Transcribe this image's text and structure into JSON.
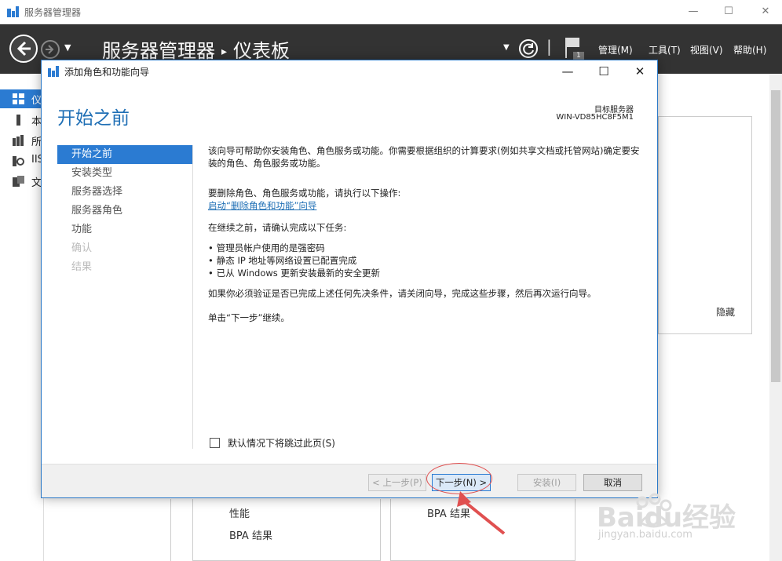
{
  "window": {
    "title": "服务器管理器",
    "buttons": {
      "minimize": "—",
      "maximize": "☐",
      "close": "✕"
    }
  },
  "header": {
    "breadcrumb_root": "服务器管理器",
    "breadcrumb_sep": "▸",
    "breadcrumb_current": "仪表板",
    "flag_badge": "1",
    "menus": [
      {
        "label": "管理(M)"
      },
      {
        "label": "工具(T)"
      },
      {
        "label": "视图(V)"
      },
      {
        "label": "帮助(H)"
      }
    ]
  },
  "sidebar": {
    "items": [
      {
        "label": "仪",
        "icon": "dashboard-icon"
      },
      {
        "label": "本",
        "icon": "local-server-icon"
      },
      {
        "label": "所",
        "icon": "all-servers-icon"
      },
      {
        "label": "IIS",
        "icon": "iis-icon"
      },
      {
        "label": "文",
        "icon": "file-services-icon"
      }
    ]
  },
  "background": {
    "hide_label": "隐藏",
    "tile_left": [
      "性能",
      "BPA 结果"
    ],
    "tile_right": [
      "BPA 结果"
    ]
  },
  "dialog": {
    "title": "添加角色和功能向导",
    "heading": "开始之前",
    "target_label": "目标服务器",
    "target_value": "WIN-VD85HC8F5M1",
    "steps": [
      {
        "label": "开始之前",
        "state": "active"
      },
      {
        "label": "安装类型",
        "state": "normal"
      },
      {
        "label": "服务器选择",
        "state": "normal"
      },
      {
        "label": "服务器角色",
        "state": "normal"
      },
      {
        "label": "功能",
        "state": "normal"
      },
      {
        "label": "确认",
        "state": "disabled"
      },
      {
        "label": "结果",
        "state": "disabled"
      }
    ],
    "content": {
      "intro": "该向导可帮助你安装角色、角色服务或功能。你需要根据组织的计算要求(例如共享文档或托管网站)确定要安装的角色、角色服务或功能。",
      "remove_text": "要删除角色、角色服务或功能，请执行以下操作:",
      "remove_link": "启动“删除角色和功能”向导",
      "before_text": "在继续之前，请确认完成以下任务:",
      "tasks": [
        "管理员帐户使用的是强密码",
        "静态 IP 地址等网络设置已配置完成",
        "已从 Windows 更新安装最新的安全更新"
      ],
      "verify_text": "如果你必须验证是否已完成上述任何先决条件，请关闭向导，完成这些步骤，然后再次运行向导。",
      "continue_text": "单击“下一步”继续。"
    },
    "skip_label": "默认情况下将跳过此页(S)",
    "buttons": {
      "prev": "< 上一步(P)",
      "next": "下一步(N) >",
      "install": "安装(I)",
      "cancel": "取消"
    }
  },
  "watermark": {
    "brand": "Baidu经验",
    "url": "jingyan.baidu.com"
  },
  "colors": {
    "accent": "#2b7bd2",
    "header_bg": "#333333",
    "heading_blue": "#1f6fb5",
    "annotation_red": "#e05050"
  }
}
